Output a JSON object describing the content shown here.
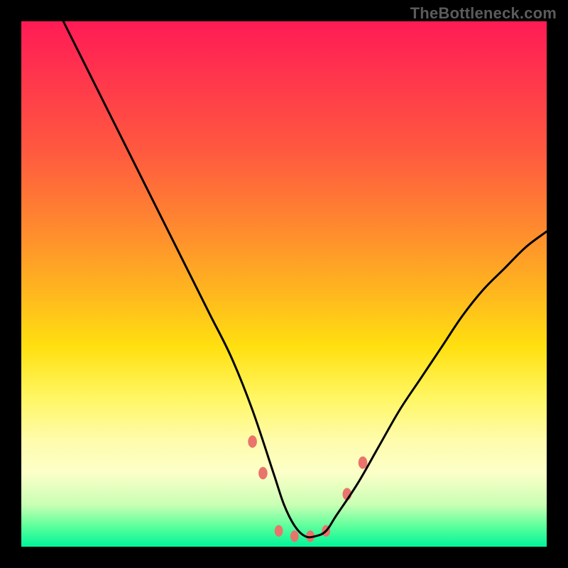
{
  "watermark": {
    "text": "TheBottleneck.com"
  },
  "chart_data": {
    "type": "line",
    "title": "",
    "xlabel": "",
    "ylabel": "",
    "xlim": [
      0,
      100
    ],
    "ylim": [
      0,
      100
    ],
    "grid": false,
    "legend": false,
    "background": {
      "type": "vertical-gradient",
      "stops": [
        {
          "pos": 0,
          "color": "#ff1b55"
        },
        {
          "pos": 25,
          "color": "#ff5a3f"
        },
        {
          "pos": 50,
          "color": "#ffb81e"
        },
        {
          "pos": 72,
          "color": "#fff766"
        },
        {
          "pos": 86,
          "color": "#fcffc8"
        },
        {
          "pos": 100,
          "color": "#00f599"
        }
      ]
    },
    "series": [
      {
        "name": "bottleneck-curve",
        "color": "#000000",
        "x": [
          8,
          12,
          16,
          20,
          24,
          28,
          32,
          36,
          40,
          44,
          48,
          50,
          52,
          54,
          56,
          58,
          60,
          64,
          68,
          72,
          76,
          80,
          84,
          88,
          92,
          96,
          100
        ],
        "y": [
          100,
          92,
          84,
          76,
          68,
          60,
          52,
          44,
          36,
          26,
          14,
          8,
          4,
          2,
          2,
          3,
          6,
          12,
          19,
          26,
          32,
          38,
          44,
          49,
          53,
          57,
          60
        ]
      }
    ],
    "markers": [
      {
        "name": "marker-left-upper",
        "x": 44,
        "y": 20,
        "color": "#e9746b",
        "size": 14
      },
      {
        "name": "marker-left-lower",
        "x": 46,
        "y": 14,
        "color": "#e9746b",
        "size": 14
      },
      {
        "name": "marker-bottom-1",
        "x": 49,
        "y": 3,
        "color": "#e9746b",
        "size": 13
      },
      {
        "name": "marker-bottom-2",
        "x": 52,
        "y": 2,
        "color": "#e9746b",
        "size": 13
      },
      {
        "name": "marker-bottom-3",
        "x": 55,
        "y": 2,
        "color": "#e9746b",
        "size": 13
      },
      {
        "name": "marker-bottom-4",
        "x": 58,
        "y": 3,
        "color": "#e9746b",
        "size": 13
      },
      {
        "name": "marker-right-lower",
        "x": 62,
        "y": 10,
        "color": "#e9746b",
        "size": 14
      },
      {
        "name": "marker-right-upper",
        "x": 65,
        "y": 16,
        "color": "#e9746b",
        "size": 14
      }
    ]
  }
}
